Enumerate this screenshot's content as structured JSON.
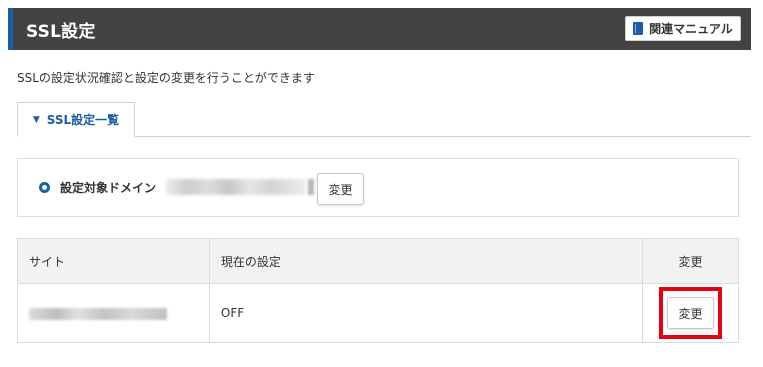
{
  "header": {
    "title": "SSL設定",
    "manual_button": {
      "label": "関連マニュアル",
      "icon": "manual-book-icon"
    },
    "accent_color": "#1b5ea8",
    "background_color": "#434343"
  },
  "description": "SSLの設定状況確認と設定の変更を行うことができます",
  "tabs": [
    {
      "label": "SSL設定一覧",
      "icon": "chevron-down-icon",
      "active": true
    }
  ],
  "domain_section": {
    "label": "設定対象ドメイン",
    "change_label": "変更"
  },
  "table": {
    "headers": [
      "サイト",
      "現在の設定",
      "変更"
    ],
    "rows": [
      {
        "setting": "OFF",
        "change_label": "変更"
      }
    ]
  },
  "highlight_color": "#e60012"
}
